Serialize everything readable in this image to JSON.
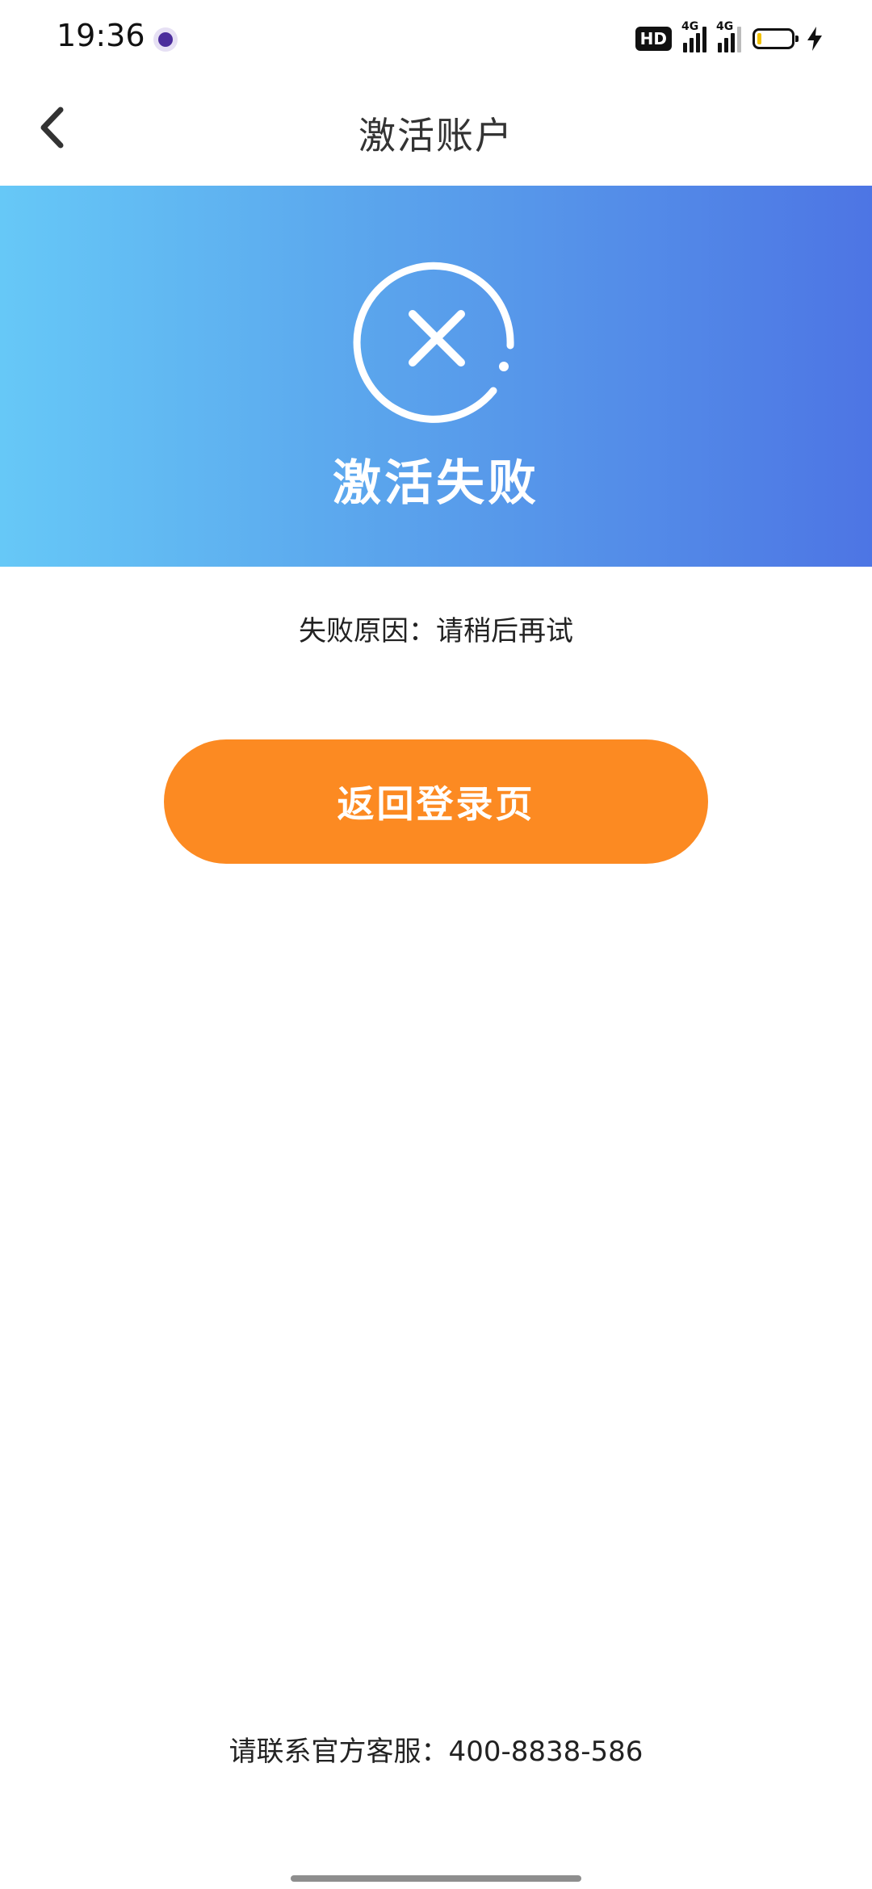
{
  "status_bar": {
    "time": "19:36",
    "hd_badge": "HD",
    "network_1": "4G",
    "network_2": "4G",
    "battery_level": 0.12,
    "charging": true
  },
  "header": {
    "title": "激活账户",
    "back_icon": "chevron-left-icon"
  },
  "banner": {
    "title": "激活失败",
    "icon": "close-circle-icon",
    "gradient_start": "#66c8f7",
    "gradient_end": "#4d75e4"
  },
  "reason_text": "失败原因：请稍后再试",
  "return_button": {
    "label": "返回登录页",
    "color": "#fc8a22"
  },
  "contact_text": "请联系官方客服：400-8838-586"
}
